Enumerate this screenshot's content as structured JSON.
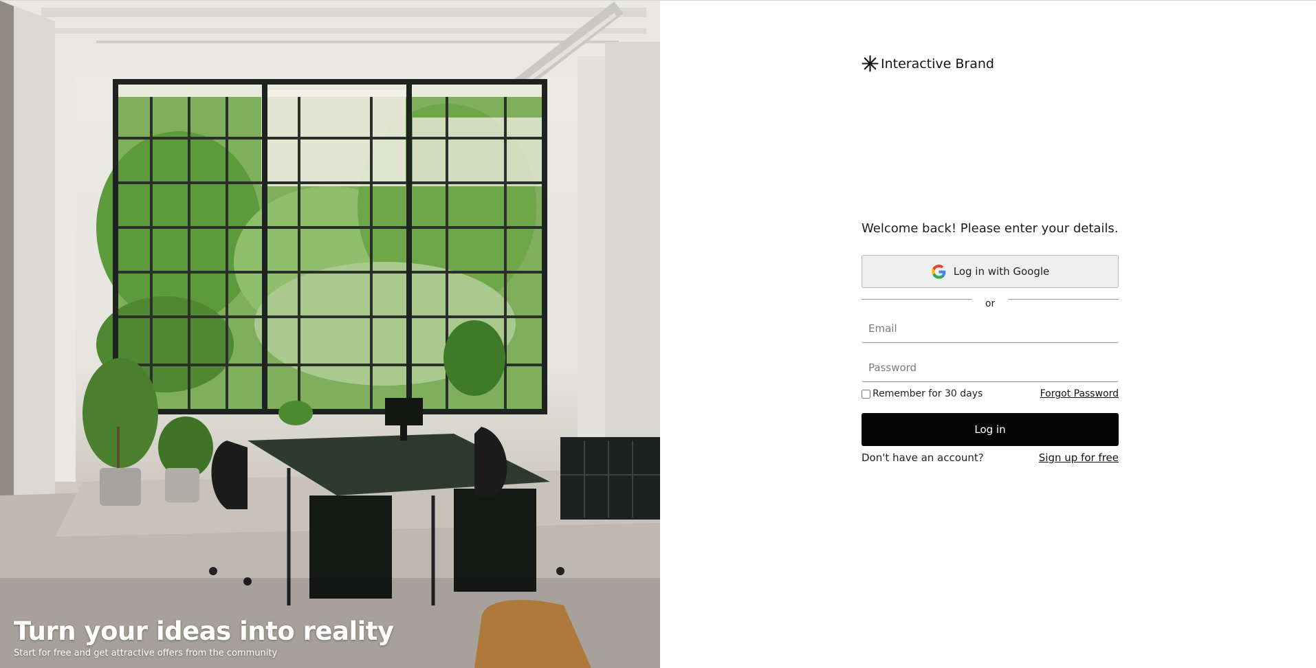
{
  "hero": {
    "title": "Turn your ideas into reality",
    "subtitle": "Start for free and get attractive offers from the community"
  },
  "brand": {
    "name": "Interactive Brand",
    "icon": "asterisk-icon"
  },
  "login": {
    "welcome": "Welcome back! Please enter your details.",
    "google_label": "Log in with Google",
    "divider": "or",
    "email_placeholder": "Email",
    "password_placeholder": "Password",
    "remember_label": "Remember for 30 days",
    "forgot_label": "Forgot Password",
    "login_label": "Log in",
    "no_account": "Don't have an account?",
    "signup_label": "Sign up for free"
  },
  "colors": {
    "primary_button": "#050505",
    "google_button_bg": "#efefef",
    "page_bg": "#ffffff"
  }
}
